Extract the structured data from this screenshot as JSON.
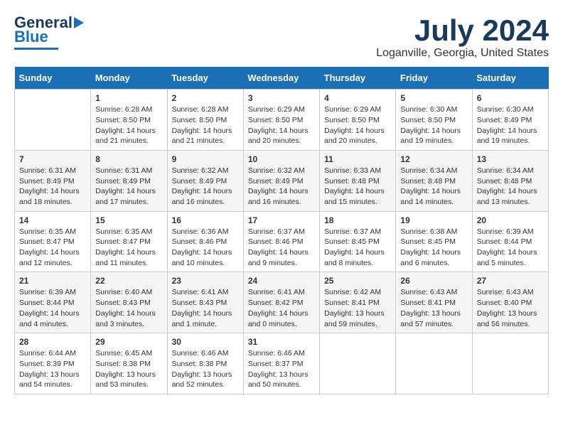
{
  "logo": {
    "line1": "General",
    "line2": "Blue"
  },
  "title": "July 2024",
  "subtitle": "Loganville, Georgia, United States",
  "days_of_week": [
    "Sunday",
    "Monday",
    "Tuesday",
    "Wednesday",
    "Thursday",
    "Friday",
    "Saturday"
  ],
  "weeks": [
    [
      {
        "day": "",
        "info": ""
      },
      {
        "day": "1",
        "info": "Sunrise: 6:28 AM\nSunset: 8:50 PM\nDaylight: 14 hours and 21 minutes."
      },
      {
        "day": "2",
        "info": "Sunrise: 6:28 AM\nSunset: 8:50 PM\nDaylight: 14 hours and 21 minutes."
      },
      {
        "day": "3",
        "info": "Sunrise: 6:29 AM\nSunset: 8:50 PM\nDaylight: 14 hours and 20 minutes."
      },
      {
        "day": "4",
        "info": "Sunrise: 6:29 AM\nSunset: 8:50 PM\nDaylight: 14 hours and 20 minutes."
      },
      {
        "day": "5",
        "info": "Sunrise: 6:30 AM\nSunset: 8:50 PM\nDaylight: 14 hours and 19 minutes."
      },
      {
        "day": "6",
        "info": "Sunrise: 6:30 AM\nSunset: 8:49 PM\nDaylight: 14 hours and 19 minutes."
      }
    ],
    [
      {
        "day": "7",
        "info": "Sunrise: 6:31 AM\nSunset: 8:49 PM\nDaylight: 14 hours and 18 minutes."
      },
      {
        "day": "8",
        "info": "Sunrise: 6:31 AM\nSunset: 8:49 PM\nDaylight: 14 hours and 17 minutes."
      },
      {
        "day": "9",
        "info": "Sunrise: 6:32 AM\nSunset: 8:49 PM\nDaylight: 14 hours and 16 minutes."
      },
      {
        "day": "10",
        "info": "Sunrise: 6:32 AM\nSunset: 8:49 PM\nDaylight: 14 hours and 16 minutes."
      },
      {
        "day": "11",
        "info": "Sunrise: 6:33 AM\nSunset: 8:48 PM\nDaylight: 14 hours and 15 minutes."
      },
      {
        "day": "12",
        "info": "Sunrise: 6:34 AM\nSunset: 8:48 PM\nDaylight: 14 hours and 14 minutes."
      },
      {
        "day": "13",
        "info": "Sunrise: 6:34 AM\nSunset: 8:48 PM\nDaylight: 14 hours and 13 minutes."
      }
    ],
    [
      {
        "day": "14",
        "info": "Sunrise: 6:35 AM\nSunset: 8:47 PM\nDaylight: 14 hours and 12 minutes."
      },
      {
        "day": "15",
        "info": "Sunrise: 6:35 AM\nSunset: 8:47 PM\nDaylight: 14 hours and 11 minutes."
      },
      {
        "day": "16",
        "info": "Sunrise: 6:36 AM\nSunset: 8:46 PM\nDaylight: 14 hours and 10 minutes."
      },
      {
        "day": "17",
        "info": "Sunrise: 6:37 AM\nSunset: 8:46 PM\nDaylight: 14 hours and 9 minutes."
      },
      {
        "day": "18",
        "info": "Sunrise: 6:37 AM\nSunset: 8:45 PM\nDaylight: 14 hours and 8 minutes."
      },
      {
        "day": "19",
        "info": "Sunrise: 6:38 AM\nSunset: 8:45 PM\nDaylight: 14 hours and 6 minutes."
      },
      {
        "day": "20",
        "info": "Sunrise: 6:39 AM\nSunset: 8:44 PM\nDaylight: 14 hours and 5 minutes."
      }
    ],
    [
      {
        "day": "21",
        "info": "Sunrise: 6:39 AM\nSunset: 8:44 PM\nDaylight: 14 hours and 4 minutes."
      },
      {
        "day": "22",
        "info": "Sunrise: 6:40 AM\nSunset: 8:43 PM\nDaylight: 14 hours and 3 minutes."
      },
      {
        "day": "23",
        "info": "Sunrise: 6:41 AM\nSunset: 8:43 PM\nDaylight: 14 hours and 1 minute."
      },
      {
        "day": "24",
        "info": "Sunrise: 6:41 AM\nSunset: 8:42 PM\nDaylight: 14 hours and 0 minutes."
      },
      {
        "day": "25",
        "info": "Sunrise: 6:42 AM\nSunset: 8:41 PM\nDaylight: 13 hours and 59 minutes."
      },
      {
        "day": "26",
        "info": "Sunrise: 6:43 AM\nSunset: 8:41 PM\nDaylight: 13 hours and 57 minutes."
      },
      {
        "day": "27",
        "info": "Sunrise: 6:43 AM\nSunset: 8:40 PM\nDaylight: 13 hours and 56 minutes."
      }
    ],
    [
      {
        "day": "28",
        "info": "Sunrise: 6:44 AM\nSunset: 8:39 PM\nDaylight: 13 hours and 54 minutes."
      },
      {
        "day": "29",
        "info": "Sunrise: 6:45 AM\nSunset: 8:38 PM\nDaylight: 13 hours and 53 minutes."
      },
      {
        "day": "30",
        "info": "Sunrise: 6:46 AM\nSunset: 8:38 PM\nDaylight: 13 hours and 52 minutes."
      },
      {
        "day": "31",
        "info": "Sunrise: 6:46 AM\nSunset: 8:37 PM\nDaylight: 13 hours and 50 minutes."
      },
      {
        "day": "",
        "info": ""
      },
      {
        "day": "",
        "info": ""
      },
      {
        "day": "",
        "info": ""
      }
    ]
  ]
}
